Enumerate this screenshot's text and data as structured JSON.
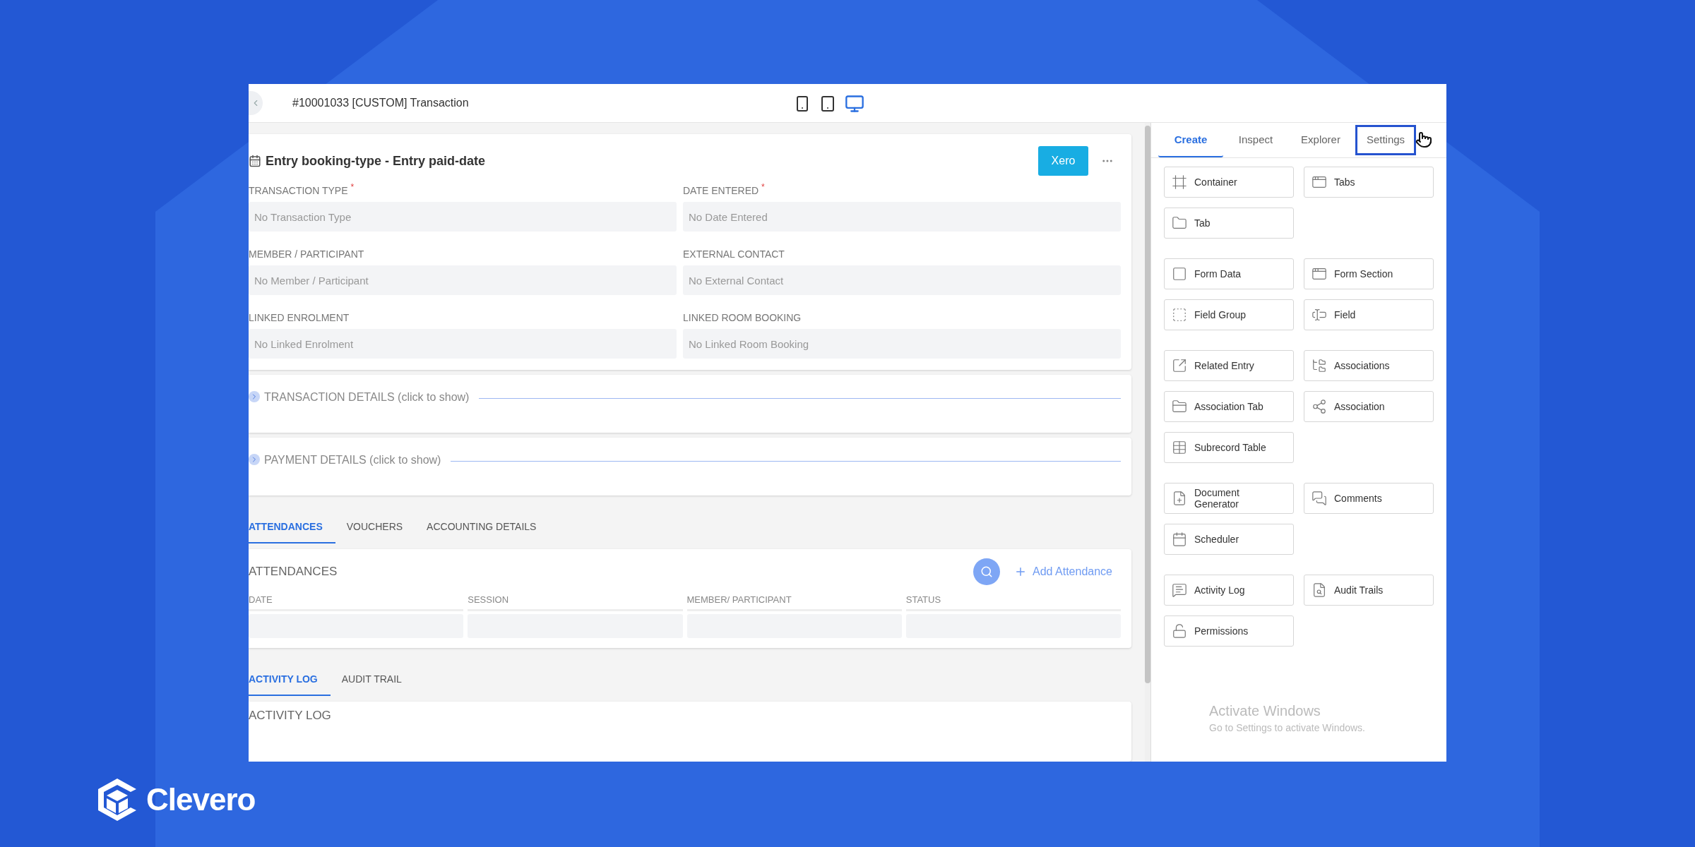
{
  "brand": {
    "name": "Clevero"
  },
  "app": {
    "title": "#10001033  [CUSTOM] Transaction",
    "devices": [
      {
        "kind": "phone",
        "selected": false
      },
      {
        "kind": "tablet",
        "selected": false
      },
      {
        "kind": "desktop",
        "selected": true
      }
    ],
    "record": {
      "heading": "Entry booking-type - Entry paid-date",
      "action": "Xero",
      "fields": [
        {
          "label": "TRANSACTION TYPE",
          "required": true,
          "placeholder": "No Transaction Type"
        },
        {
          "label": "DATE ENTERED",
          "required": true,
          "placeholder": "No Date Entered"
        },
        {
          "label": "MEMBER / PARTICIPANT",
          "required": false,
          "placeholder": "No Member / Participant"
        },
        {
          "label": "EXTERNAL CONTACT",
          "required": false,
          "placeholder": "No External Contact"
        },
        {
          "label": "LINKED ENROLMENT",
          "required": false,
          "placeholder": "No Linked Enrolment"
        },
        {
          "label": "LINKED ROOM BOOKING",
          "required": false,
          "placeholder": "No Linked Room Booking"
        }
      ],
      "required_mark": "*"
    },
    "sections": [
      {
        "title": "TRANSACTION DETAILS (click to show)",
        "expanded": false
      },
      {
        "title": "PAYMENT DETAILS (click to show)",
        "expanded": false
      }
    ],
    "tabs": [
      {
        "label": "ATTENDANCES",
        "selected": true
      },
      {
        "label": "VOUCHERS",
        "selected": false
      },
      {
        "label": "ACCOUNTING DETAILS",
        "selected": false
      }
    ],
    "attendances": {
      "title": "ATTENDANCES",
      "add_label": "Add Attendance",
      "columns": [
        "DATE",
        "SESSION",
        "MEMBER/ PARTICIPANT",
        "STATUS"
      ]
    },
    "log_tabs": [
      {
        "label": "ACTIVITY LOG",
        "selected": true
      },
      {
        "label": "AUDIT TRAIL",
        "selected": false
      }
    ],
    "log": {
      "title": "ACTIVITY LOG"
    },
    "panel": {
      "tabs": [
        {
          "label": "Create",
          "selected": true,
          "highlighted": false
        },
        {
          "label": "Inspect",
          "selected": false,
          "highlighted": false
        },
        {
          "label": "Explorer",
          "selected": false,
          "highlighted": false
        },
        {
          "label": "Settings",
          "selected": false,
          "highlighted": true
        }
      ],
      "groups": [
        [
          "Container",
          "Tabs",
          "Tab"
        ],
        [
          "Form Data",
          "Form Section",
          "Field Group",
          "Field"
        ],
        [
          "Related Entry",
          "Associations",
          "Association Tab",
          "Association",
          "Subrecord Table"
        ],
        [
          "Document Generator",
          "Comments",
          "Scheduler"
        ],
        [
          "Activity Log",
          "Audit Trails",
          "Permissions"
        ]
      ]
    },
    "os_notice": {
      "title": "Activate Windows",
      "subtitle": "Go to Settings to activate Windows."
    }
  }
}
